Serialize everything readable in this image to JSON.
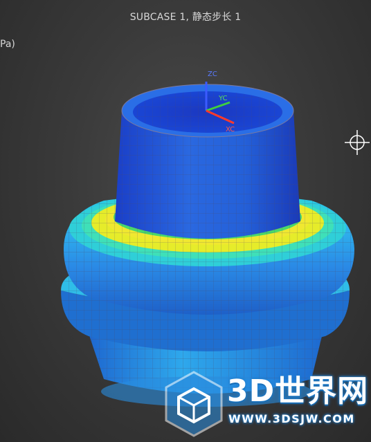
{
  "viewport": {
    "title": "SUBCASE 1, 静态步长 1",
    "unit_label": "Pa)"
  },
  "axes": {
    "z_label": "ZC",
    "y_label": "YC",
    "x_label": "XC"
  },
  "watermark": {
    "brand": "3D世界网",
    "url": "WWW.3DSJW.COM"
  },
  "colors": {
    "background": "#3a3a3a",
    "contour_low": "#1e3fd0",
    "contour_mid_low": "#2f8fe8",
    "contour_mid": "#27d8d0",
    "contour_mid_high": "#e8ee2a",
    "contour_high": "#d82a1a",
    "mesh_line": "#6a6a8a",
    "axis_z": "#3b5bff",
    "axis_y": "#3fcf3f",
    "axis_x": "#ff3a2a"
  },
  "icons": {
    "cursor": "crosshair-icon",
    "logo": "cube-logo-icon"
  }
}
